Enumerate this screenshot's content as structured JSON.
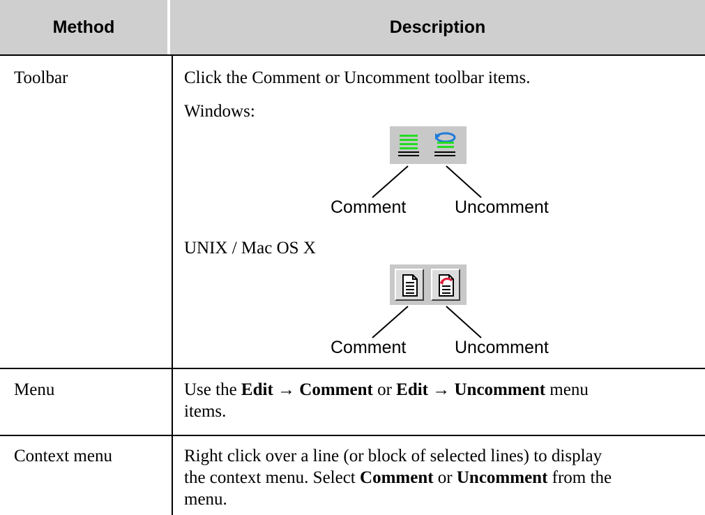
{
  "header": {
    "method": "Method",
    "description": "Description"
  },
  "rows": {
    "toolbar": {
      "method": "Toolbar",
      "intro": "Click the Comment or Uncomment toolbar items.",
      "windows_label": "Windows:",
      "unix_label": "UNIX / Mac OS X",
      "comment_label": "Comment",
      "uncomment_label": "Uncomment"
    },
    "menu": {
      "method": "Menu",
      "t1": "Use the ",
      "b1": "Edit",
      "arrow1": " → ",
      "b2": "Comment",
      "t2": " or ",
      "b3": "Edit",
      "arrow2": " → ",
      "b4": "Uncomment",
      "t3": " menu",
      "t4": "items."
    },
    "context": {
      "method": "Context menu",
      "line1": "Right click over a line (or block of selected lines) to display",
      "t1": "the context menu. Select ",
      "b1": "Comment",
      "t2": " or ",
      "b2": "Uncomment",
      "t3": " from the",
      "line3": "menu."
    }
  },
  "icons": {
    "windows_comment": "comment-lines-icon",
    "windows_uncomment": "uncomment-lines-icon",
    "unix_comment": "comment-document-icon",
    "unix_uncomment": "uncomment-document-icon"
  }
}
